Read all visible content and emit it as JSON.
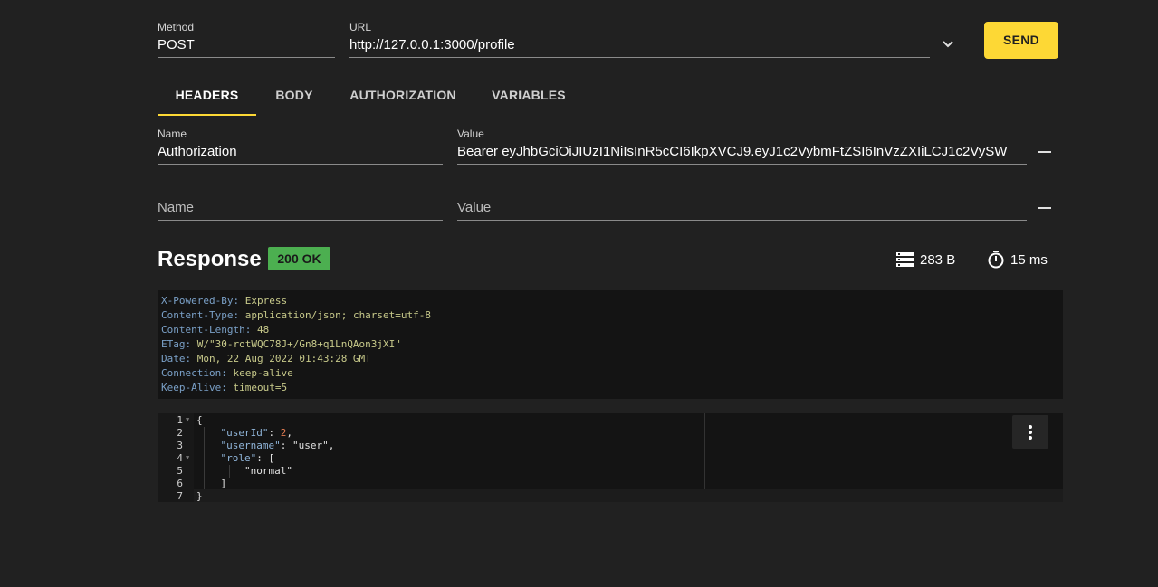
{
  "request": {
    "method_label": "Method",
    "method_value": "POST",
    "url_label": "URL",
    "url_value": "http://127.0.0.1:3000/profile",
    "send_label": "SEND"
  },
  "tabs": [
    {
      "label": "HEADERS",
      "active": true
    },
    {
      "label": "BODY",
      "active": false
    },
    {
      "label": "AUTHORIZATION",
      "active": false
    },
    {
      "label": "VARIABLES",
      "active": false
    }
  ],
  "headers_form": {
    "rows": [
      {
        "name_label": "Name",
        "name_value": "Authorization",
        "value_label": "Value",
        "value_value": "Bearer eyJhbGciOiJIUzI1NiIsInR5cCI6IkpXVCJ9.eyJ1c2VybmFtZSI6InVzZXIiLCJ1c2VySW"
      },
      {
        "name_placeholder": "Name",
        "value_placeholder": "Value"
      }
    ]
  },
  "response": {
    "title": "Response",
    "status": "200 OK",
    "size": "283 B",
    "time": "15 ms",
    "headers": [
      {
        "key": "X-Powered-By",
        "value": "Express"
      },
      {
        "key": "Content-Type",
        "value": "application/json; charset=utf-8"
      },
      {
        "key": "Content-Length",
        "value": "48"
      },
      {
        "key": "ETag",
        "value": "W/\"30-rotWQC78J+/Gn8+q1LnQAon3jXI\""
      },
      {
        "key": "Date",
        "value": "Mon, 22 Aug 2022 01:43:28 GMT"
      },
      {
        "key": "Connection",
        "value": "keep-alive"
      },
      {
        "key": "Keep-Alive",
        "value": "timeout=5"
      }
    ],
    "body_lines": [
      {
        "num": "1",
        "fold": true,
        "text": "{"
      },
      {
        "num": "2",
        "fold": false,
        "text": "    \"userId\": 2,"
      },
      {
        "num": "3",
        "fold": false,
        "text": "    \"username\": \"user\","
      },
      {
        "num": "4",
        "fold": true,
        "text": "    \"role\": ["
      },
      {
        "num": "5",
        "fold": false,
        "text": "        \"normal\""
      },
      {
        "num": "6",
        "fold": false,
        "text": "    ]"
      },
      {
        "num": "7",
        "fold": false,
        "text": "}"
      }
    ]
  },
  "colors": {
    "accent": "#fdd835",
    "status_ok": "#4caf50",
    "background": "#212121"
  },
  "icons": {
    "dropdown": "chevron-down-icon",
    "size": "list-icon",
    "time": "stopwatch-icon",
    "menu": "more-vertical-icon"
  }
}
